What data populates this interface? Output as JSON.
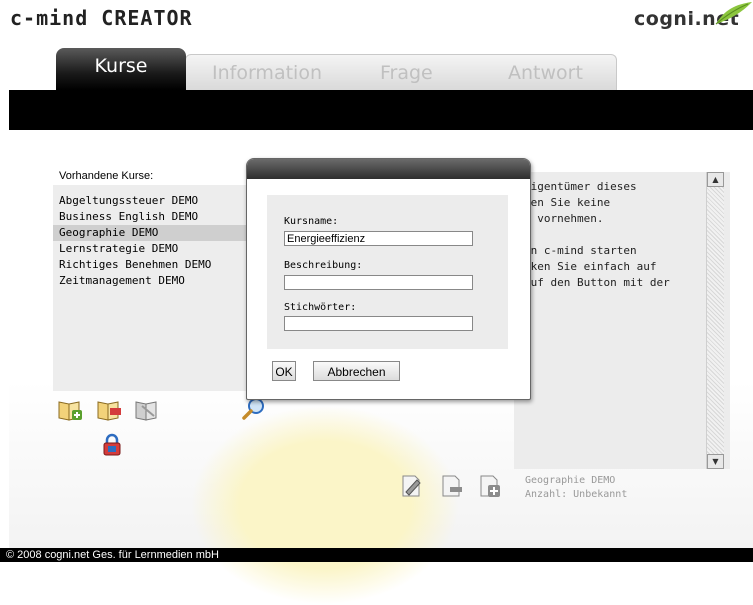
{
  "app": {
    "title": "c-mind CREATOR",
    "brand": "cogni.net"
  },
  "tabs": [
    {
      "label": "Kurse",
      "active": true
    },
    {
      "label": "Information",
      "active": false
    },
    {
      "label": "Frage",
      "active": false
    },
    {
      "label": "Antwort",
      "active": false
    }
  ],
  "courses": {
    "label": "Vorhandene Kurse:",
    "items": [
      {
        "label": "Abgeltungssteuer DEMO",
        "selected": false
      },
      {
        "label": "Business English DEMO",
        "selected": false
      },
      {
        "label": "Geographie DEMO",
        "selected": true
      },
      {
        "label": "Lernstrategie DEMO",
        "selected": false
      },
      {
        "label": "Richtiges Benehmen DEMO",
        "selected": false
      },
      {
        "label": "Zeitmanagement DEMO",
        "selected": false
      }
    ]
  },
  "description": {
    "lines": [
      "Eigentümer dieses",
      "hen Sie keine",
      "s vornehmen.",
      "",
      "in c-mind starten",
      "cken Sie einfach auf",
      "auf den Button mit der"
    ]
  },
  "dialog": {
    "kursname_label": "Kursname:",
    "kursname_value": "Energieeffizienz",
    "beschreibung_label": "Beschreibung:",
    "beschreibung_value": "",
    "stichwoerter_label": "Stichwörter:",
    "stichwoerter_value": "",
    "ok_label": "OK",
    "cancel_label": "Abbrechen"
  },
  "status": {
    "course_name": "Geographie DEMO",
    "count_text": "Anzahl: Unbekannt"
  },
  "footer": {
    "copyright": "© 2008 cogni.net Ges. für Lernmedien mbH"
  },
  "icons": {
    "add_course": "book-add-icon",
    "edit_course": "book-edit-icon",
    "delete_course": "book-delete-icon",
    "search": "magnifier-icon",
    "lock": "lock-icon",
    "edit_page": "pencil-page-icon",
    "remove_page": "page-remove-icon",
    "add_page": "page-add-icon"
  },
  "colors": {
    "tab_active_bg": "#1a1a1a",
    "selection_bg": "#cfcfcf",
    "icon_green": "#5aa02c",
    "icon_red": "#d43c3c",
    "icon_blue": "#2d6cc0"
  }
}
